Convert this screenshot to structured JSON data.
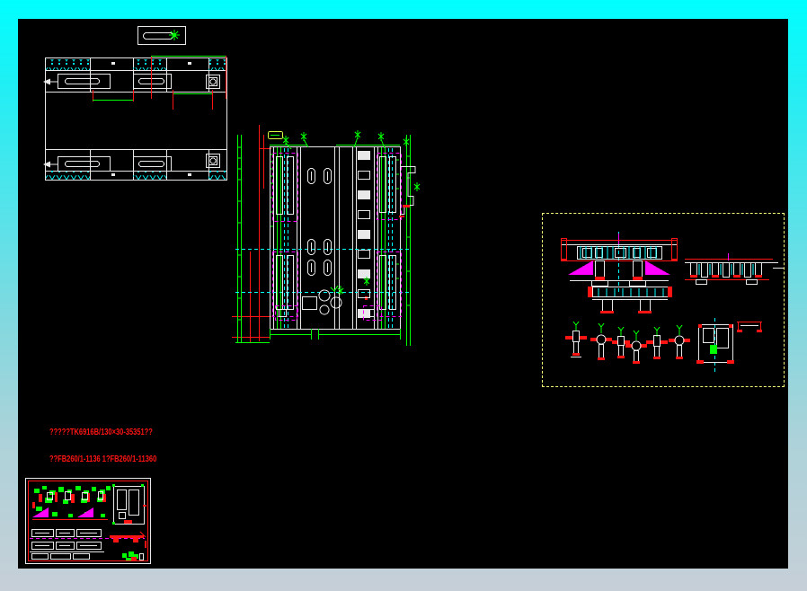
{
  "frame": {
    "gradient_top": "#00ffff",
    "gradient_bottom": "#c6cfd8"
  },
  "canvas": {
    "background": "#000000"
  },
  "palette": {
    "line_white": "#e8e8e8",
    "red": "#ff1414",
    "green": "#00ff00",
    "cyan": "#00ffff",
    "magenta": "#ff00ff",
    "panel_border_yellow": "#f5f57a"
  },
  "notes": {
    "line1": "?????TK6916B/130×30-35351??",
    "line2": "??FB260/1-1136 1?FB260/1-11360"
  }
}
